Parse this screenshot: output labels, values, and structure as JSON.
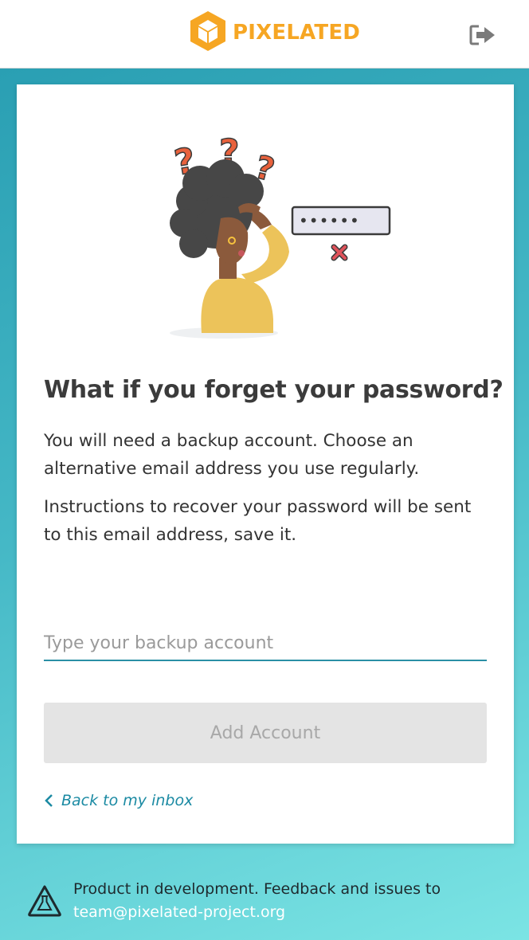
{
  "header": {
    "logo_text": "PIXELATED",
    "logo_icon": "cube-logo-icon",
    "logout_icon": "logout-icon",
    "brand_color": "#f6a623"
  },
  "card": {
    "illustration": "forgot-password-illustration",
    "illustration_password_mask": "••••••",
    "title": "What if you forget your password?",
    "paragraph_1": "You will need a backup account. Choose an alternative email address you use regularly.",
    "paragraph_2": "Instructions to recover your password will be sent to this email address, save it.",
    "backup_input": {
      "value": "",
      "placeholder": "Type your backup account"
    },
    "add_button_label": "Add Account",
    "back_link_label": "Back to my inbox"
  },
  "footer": {
    "notice": "Product in development. Feedback and issues to",
    "email": "team@pixelated-project.org",
    "icon": "warning-flask-icon"
  },
  "colors": {
    "accent": "#1b8aa3",
    "background_gradient_start": "#2a9fb3",
    "background_gradient_end": "#7be4e4",
    "button_disabled_bg": "#e4e4e4"
  }
}
